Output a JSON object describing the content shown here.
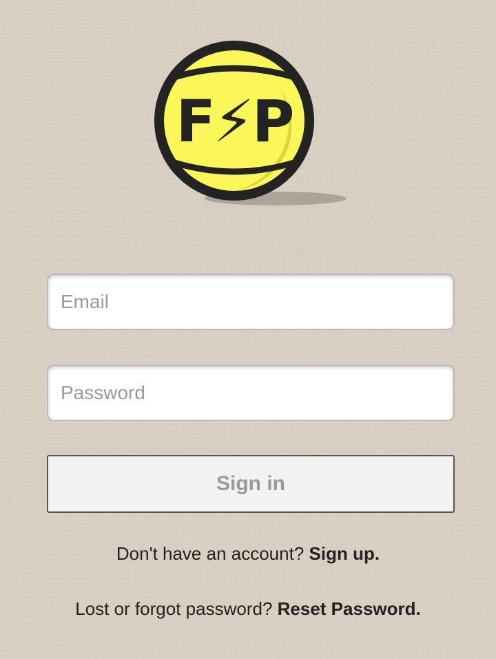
{
  "logo": {
    "text": "F⚡P",
    "colors": {
      "ball": "#fbf75a",
      "shade": "#d8d444",
      "outline": "#232323",
      "shadow": "#9c958a"
    }
  },
  "form": {
    "email": {
      "placeholder": "Email",
      "value": ""
    },
    "password": {
      "placeholder": "Password",
      "value": ""
    },
    "signin_label": "Sign in"
  },
  "links": {
    "signup_prompt": "Don't have an account?",
    "signup_link": "Sign up.",
    "reset_prompt": "Lost or forgot password?",
    "reset_link": "Reset Password."
  }
}
